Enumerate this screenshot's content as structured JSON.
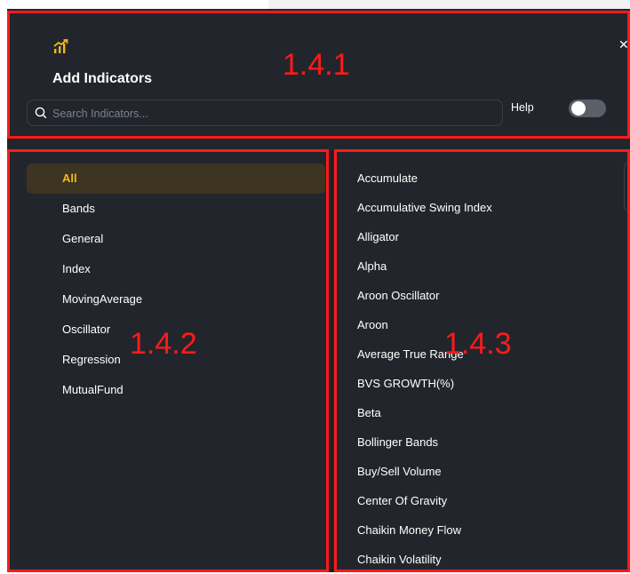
{
  "header": {
    "title": "Add Indicators",
    "close_symbol": "✕",
    "search_placeholder": "Search Indicators...",
    "help_label": "Help",
    "icon": "chart-up-icon"
  },
  "categories": [
    {
      "label": "All",
      "active": true
    },
    {
      "label": "Bands",
      "active": false
    },
    {
      "label": "General",
      "active": false
    },
    {
      "label": "Index",
      "active": false
    },
    {
      "label": "MovingAverage",
      "active": false
    },
    {
      "label": "Oscillator",
      "active": false
    },
    {
      "label": "Regression",
      "active": false
    },
    {
      "label": "MutualFund",
      "active": false
    }
  ],
  "indicators": [
    "Accumulate",
    "Accumulative Swing Index",
    "Alligator",
    "Alpha",
    "Aroon Oscillator",
    "Aroon",
    "Average True Range",
    "BVS GROWTH(%)",
    "Beta",
    "Bollinger Bands",
    "Buy/Sell Volume",
    "Center Of Gravity",
    "Chaikin Money Flow",
    "Chaikin Volatility"
  ],
  "annotations": {
    "header_label": "1.4.1",
    "categories_label": "1.4.2",
    "indicators_label": "1.4.3"
  },
  "colors": {
    "background": "#22262c",
    "accent": "#f3b81b",
    "annotation": "#ff1a1a"
  }
}
